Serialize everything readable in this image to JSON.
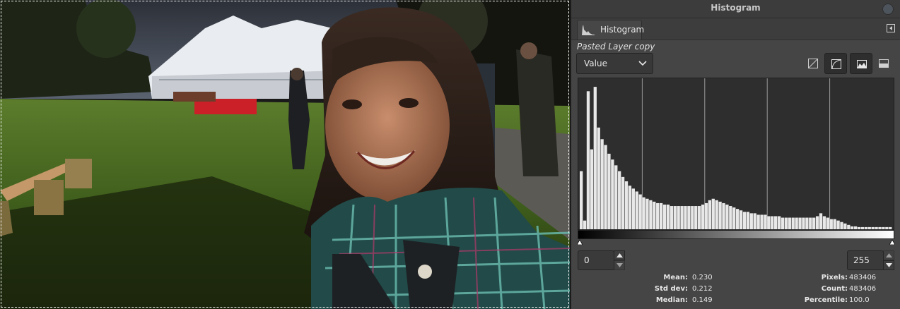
{
  "canvas": {
    "image_description_icon": "photo-canvas"
  },
  "dock": {
    "title": "Histogram",
    "tab_label": "Histogram",
    "layer_name": "Pasted Layer copy",
    "channel": "Value",
    "range_low": "0",
    "range_high": "255"
  },
  "stats": {
    "mean_label": "Mean:",
    "mean": "0.230",
    "stddev_label": "Std dev:",
    "stddev": "0.212",
    "median_label": "Median:",
    "median": "0.149",
    "pixels_label": "Pixels:",
    "pixels": "483406",
    "count_label": "Count:",
    "count": "483406",
    "percentile_label": "Percentile:",
    "percentile": "100.0"
  },
  "icons": {
    "tab": "histogram-icon",
    "linear": "linear-scale-icon",
    "log": "log-scale-icon",
    "mode_a": "histogram-outline-icon",
    "mode_b": "histogram-filled-icon"
  },
  "chart_data": {
    "type": "bar",
    "x_range": [
      0,
      255
    ],
    "scale": "logarithmic",
    "values_relative": [
      0.4,
      0.06,
      0.95,
      0.55,
      0.98,
      0.7,
      0.62,
      0.58,
      0.52,
      0.48,
      0.44,
      0.4,
      0.36,
      0.33,
      0.3,
      0.28,
      0.26,
      0.24,
      0.22,
      0.21,
      0.2,
      0.19,
      0.18,
      0.18,
      0.17,
      0.17,
      0.16,
      0.16,
      0.16,
      0.16,
      0.16,
      0.16,
      0.16,
      0.16,
      0.16,
      0.17,
      0.18,
      0.2,
      0.21,
      0.2,
      0.19,
      0.18,
      0.17,
      0.16,
      0.15,
      0.14,
      0.13,
      0.12,
      0.12,
      0.11,
      0.11,
      0.1,
      0.1,
      0.1,
      0.09,
      0.09,
      0.09,
      0.09,
      0.08,
      0.08,
      0.08,
      0.08,
      0.08,
      0.08,
      0.08,
      0.08,
      0.08,
      0.08,
      0.09,
      0.11,
      0.09,
      0.08,
      0.07,
      0.07,
      0.06,
      0.05,
      0.04,
      0.03,
      0.02,
      0.02,
      0.015,
      0.015,
      0.015,
      0.015,
      0.015,
      0.015,
      0.015,
      0.015,
      0.015,
      0.015
    ],
    "grid_lines": 4
  }
}
